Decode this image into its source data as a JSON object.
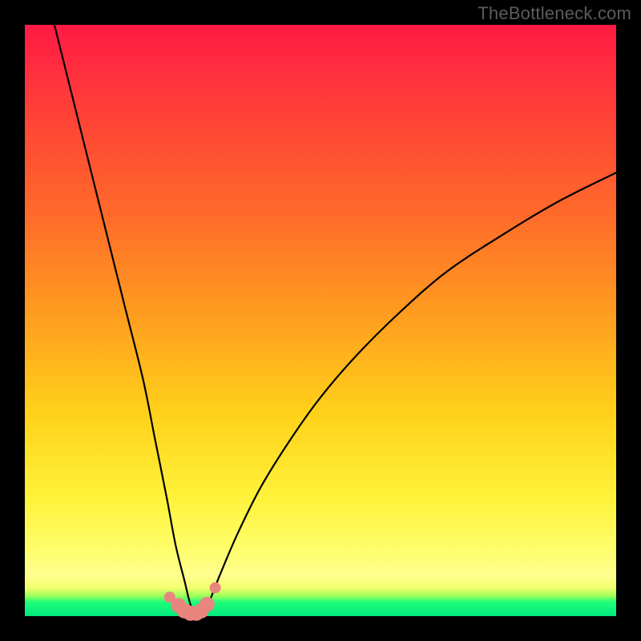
{
  "watermark": "TheBottleneck.com",
  "chart_data": {
    "type": "line",
    "title": "",
    "xlabel": "",
    "ylabel": "",
    "xlim": [
      0,
      100
    ],
    "ylim": [
      0,
      100
    ],
    "series": [
      {
        "name": "bottleneck-curve",
        "x": [
          5,
          8,
          11,
          14,
          17,
          20,
          22,
          24,
          25.5,
          27,
          28,
          29,
          30,
          31,
          33,
          36,
          40,
          45,
          50,
          56,
          63,
          71,
          80,
          90,
          100
        ],
        "y": [
          100,
          88,
          76,
          64,
          52,
          40,
          30,
          20,
          12,
          6,
          2,
          0.5,
          0.5,
          2,
          7,
          14,
          22,
          30,
          37,
          44,
          51,
          58,
          64,
          70,
          75
        ]
      }
    ],
    "markers": {
      "name": "highlight-points",
      "x": [
        24.5,
        26.0,
        27.0,
        28.0,
        29.0,
        29.8,
        30.8,
        32.2
      ],
      "y": [
        3.2,
        1.8,
        0.9,
        0.5,
        0.5,
        0.9,
        2.0,
        4.8
      ]
    },
    "gradient_stops": [
      {
        "pos": 0.0,
        "color": "#ff1a44"
      },
      {
        "pos": 0.5,
        "color": "#ffa01f"
      },
      {
        "pos": 0.88,
        "color": "#fffe6a"
      },
      {
        "pos": 0.97,
        "color": "#1fff7a"
      },
      {
        "pos": 1.0,
        "color": "#00e87a"
      }
    ]
  }
}
